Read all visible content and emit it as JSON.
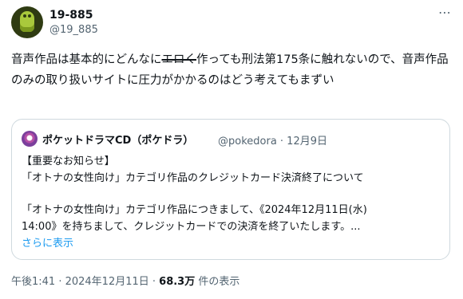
{
  "author": {
    "display_name": "19-885",
    "handle": "@19_885",
    "avatar_icon": "green-alien-avatar"
  },
  "more_icon": "⋯",
  "post": {
    "text_before_strike": "音声作品は基本的にどんなに",
    "struck_text": "エロく",
    "text_after_strike": "作っても刑法第175条に触れないので、音声作品のみの取り扱いサイトに圧力がかかるのはどう考えてもまずい"
  },
  "quoted": {
    "display_name": "ポケットドラマCD（ポケドラ）",
    "meta": "@pokedora · 12月9日",
    "lines": [
      "【重要なお知らせ】",
      "「オトナの女性向け」カテゴリ作品のクレジットカード決済終了について",
      "",
      "「オトナの女性向け」カテゴリ作品につきまして、《2024年12月11日(水)",
      "14:00》を持ちまして、クレジットカードでの決済を終了いたします。..."
    ],
    "show_more": "さらに表示"
  },
  "footer": {
    "timestamp": "午後1:41 · 2024年12月11日 · ",
    "views_count": "68.3万",
    "views_label": " 件の表示"
  },
  "colors": {
    "link": "#1d9bf0",
    "muted": "#536471",
    "text": "#0f1419",
    "border": "#cfd9de"
  }
}
